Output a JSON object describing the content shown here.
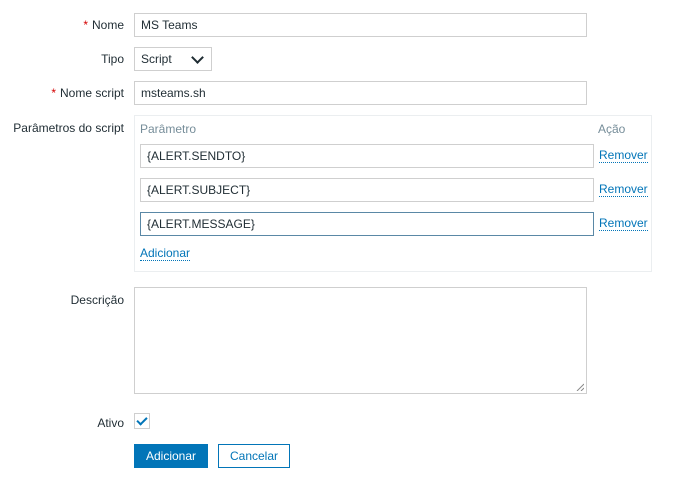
{
  "form": {
    "name": {
      "required_mark": "*",
      "label": "Nome",
      "value": "MS Teams"
    },
    "type": {
      "label": "Tipo",
      "selected": "Script"
    },
    "script_name": {
      "required_mark": "*",
      "label": "Nome script",
      "value": "msteams.sh"
    },
    "script_params": {
      "label": "Parâmetros do script",
      "column_param": "Parâmetro",
      "column_action": "Ação",
      "rows": [
        {
          "value": "{ALERT.SENDTO}",
          "remove_label": "Remover"
        },
        {
          "value": "{ALERT.SUBJECT}",
          "remove_label": "Remover"
        },
        {
          "value": "{ALERT.MESSAGE}",
          "remove_label": "Remover"
        }
      ],
      "add_label": "Adicionar"
    },
    "description": {
      "label": "Descrição",
      "value": ""
    },
    "active": {
      "label": "Ativo",
      "checked": true
    },
    "buttons": {
      "submit_label": "Adicionar",
      "cancel_label": "Cancelar"
    }
  },
  "colors": {
    "accent": "#0275b8",
    "required": "#d40000",
    "border": "#cfcfcf",
    "focus_border": "#5a88a6",
    "muted_text": "#768d99"
  }
}
